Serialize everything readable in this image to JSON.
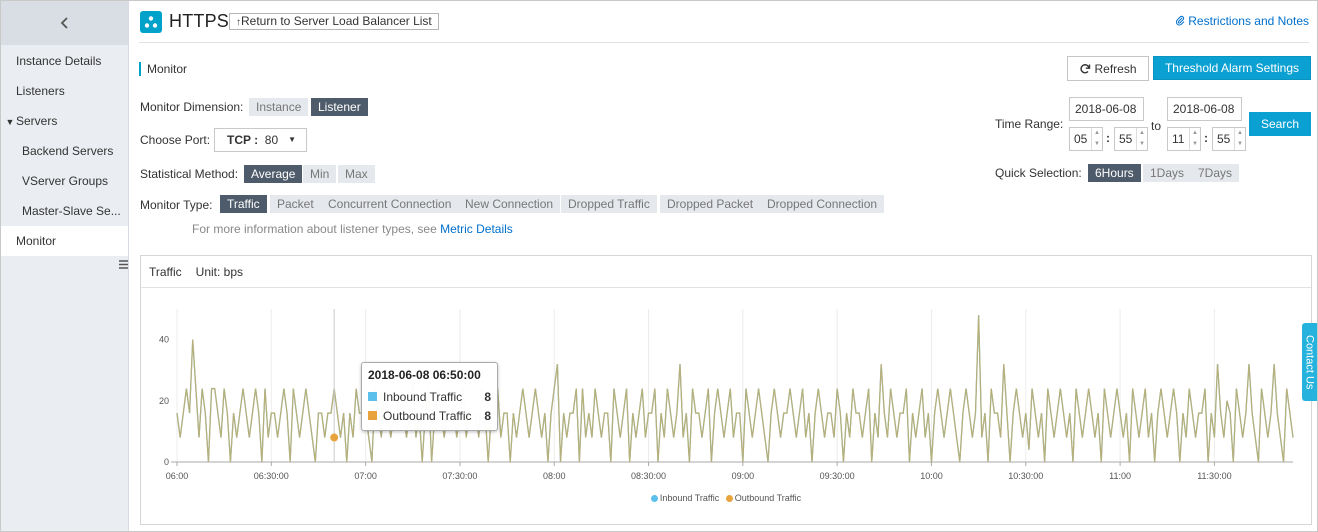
{
  "sidebar": {
    "back_icon": "chevron-left-icon",
    "items": [
      {
        "label": "Instance Details"
      },
      {
        "label": "Listeners"
      },
      {
        "label": "Servers"
      },
      {
        "label": "Backend Servers"
      },
      {
        "label": "VServer Groups"
      },
      {
        "label": "Master-Slave Se..."
      },
      {
        "label": "Monitor",
        "active": true
      }
    ]
  },
  "header": {
    "title": "HTTPS",
    "back_label": "Return to Server Load Balancer List",
    "restrictions_label": "Restrictions and Notes"
  },
  "section": {
    "title": "Monitor",
    "refresh_label": "Refresh",
    "alarm_label": "Threshold Alarm Settings"
  },
  "filters": {
    "dimension_label": "Monitor Dimension:",
    "dimension_options": [
      "Instance",
      "Listener"
    ],
    "dimension_selected": "Listener",
    "port_label": "Choose Port:",
    "port_protocol": "TCP :",
    "port_value": "80",
    "method_label": "Statistical Method:",
    "method_options": [
      "Average",
      "Min",
      "Max"
    ],
    "method_selected": "Average",
    "type_label": "Monitor Type:",
    "type_options": [
      "Traffic",
      "Packet",
      "Concurrent Connection",
      "New Connection",
      "Dropped Traffic",
      "Dropped Packet",
      "Dropped Connection"
    ],
    "type_selected": "Traffic",
    "info_text": "For more information about listener types, see ",
    "info_link": "Metric Details"
  },
  "time_range": {
    "label": "Time Range:",
    "start_date": "2018-06-08",
    "start_hour": "05",
    "start_minute": "55",
    "to_label": "to",
    "end_date": "2018-06-08",
    "end_hour": "11",
    "end_minute": "55",
    "search_label": "Search",
    "quick_label": "Quick Selection:",
    "quick_options": [
      "6Hours",
      "1Days",
      "7Days"
    ],
    "quick_selected": "6Hours"
  },
  "chart_panel": {
    "title": "Traffic",
    "unit": "Unit: bps"
  },
  "tooltip": {
    "time": "2018-06-08 06:50:00",
    "rows": [
      {
        "name": "Inbound Traffic",
        "value": "8"
      },
      {
        "name": "Outbound Traffic",
        "value": "8"
      }
    ]
  },
  "contact_label": "Contact Us",
  "colors": {
    "accent": "#0aa0d2",
    "inbound": "#5bc0eb",
    "outbound": "#e8a33d",
    "line": "#b8b07a"
  },
  "chart_data": {
    "type": "line",
    "title": "Traffic",
    "ylabel": "Unit: bps",
    "ylim": [
      0,
      50
    ],
    "yticks": [
      0,
      20,
      40
    ],
    "x_range": [
      "06:00",
      "11:55"
    ],
    "xticks": [
      "06:00",
      "06:30:00",
      "07:00",
      "07:30:00",
      "08:00",
      "08:30:00",
      "09:00",
      "09:30:00",
      "10:00",
      "10:30:00",
      "11:00",
      "11:30:00"
    ],
    "legend": "bottom-center",
    "grid": true,
    "series": [
      {
        "name": "Inbound Traffic",
        "color": "#5bc0eb",
        "x_start": "06:00",
        "interval_minutes": 1,
        "values": [
          16,
          8,
          16,
          24,
          16,
          40,
          24,
          8,
          24,
          16,
          0,
          24,
          24,
          16,
          8,
          24,
          16,
          0,
          16,
          8,
          16,
          24,
          16,
          8,
          16,
          24,
          16,
          0,
          24,
          8,
          16,
          16,
          8,
          16,
          24,
          16,
          0,
          24,
          16,
          8,
          16,
          24,
          16,
          8,
          0,
          16,
          16,
          8,
          16,
          16,
          24,
          16,
          8,
          16,
          0,
          16,
          8,
          24,
          16,
          16,
          16,
          8,
          0,
          24,
          16,
          8,
          24,
          16,
          8,
          16,
          16,
          24,
          16,
          8,
          16,
          28,
          8,
          16,
          0,
          16,
          24,
          0,
          16,
          24,
          16,
          8,
          16,
          24,
          16,
          8,
          16,
          24,
          8,
          16,
          16,
          16,
          8,
          24,
          16,
          0,
          16,
          16,
          24,
          8,
          16,
          16,
          0,
          16,
          8,
          16,
          24,
          16,
          8,
          16,
          24,
          16,
          8,
          16,
          0,
          16,
          24,
          32,
          0,
          16,
          8,
          16,
          16,
          24,
          0,
          24,
          8,
          16,
          8,
          24,
          16,
          8,
          16,
          16,
          0,
          24,
          16,
          8,
          16,
          24,
          0,
          16,
          8,
          16,
          24,
          8,
          16,
          16,
          24,
          0,
          16,
          8,
          24,
          16,
          8,
          16,
          32,
          8,
          16,
          0,
          24,
          16,
          16,
          8,
          16,
          24,
          0,
          16,
          24,
          16,
          8,
          16,
          24,
          8,
          16,
          16,
          0,
          24,
          16,
          8,
          16,
          24,
          16,
          8,
          0,
          16,
          24,
          16,
          8,
          16,
          16,
          24,
          16,
          8,
          16,
          24,
          8,
          16,
          0,
          16,
          24,
          16,
          8,
          16,
          16,
          8,
          24,
          16,
          0,
          16,
          8,
          24,
          16,
          16,
          8,
          16,
          24,
          0,
          16,
          8,
          32,
          16,
          8,
          24,
          16,
          8,
          16,
          16,
          24,
          0,
          16,
          8,
          16,
          24,
          8,
          16,
          0,
          16,
          24,
          16,
          8,
          16,
          24,
          16,
          8,
          0,
          16,
          24,
          16,
          8,
          16,
          48,
          8,
          16,
          0,
          24,
          16,
          16,
          8,
          32,
          16,
          0,
          16,
          24,
          16,
          8,
          16,
          4,
          24,
          16,
          8,
          16,
          0,
          24,
          16,
          8,
          16,
          24,
          16,
          8,
          16,
          0,
          24,
          16,
          8,
          16,
          24,
          16,
          8,
          16,
          0,
          24,
          16,
          8,
          16,
          24,
          16,
          8,
          16,
          0,
          24,
          16,
          8,
          16,
          24,
          8,
          16,
          0,
          16,
          24,
          16,
          8,
          16,
          24,
          16,
          0,
          16,
          8,
          24,
          16,
          8,
          16,
          16,
          24,
          0,
          16,
          8,
          32,
          16,
          8,
          20,
          16,
          0,
          24,
          16,
          8,
          16,
          32,
          16,
          8,
          0,
          24,
          16,
          8,
          16,
          32,
          16,
          8,
          0,
          24,
          16,
          8
        ]
      },
      {
        "name": "Outbound Traffic",
        "color": "#e8a33d",
        "x_start": "06:00",
        "interval_minutes": 1,
        "values": [
          16,
          8,
          16,
          24,
          16,
          40,
          24,
          8,
          24,
          16,
          0,
          24,
          24,
          16,
          8,
          24,
          16,
          0,
          16,
          8,
          16,
          24,
          16,
          8,
          16,
          24,
          16,
          0,
          24,
          8,
          16,
          16,
          8,
          16,
          24,
          16,
          0,
          24,
          16,
          8,
          16,
          24,
          16,
          8,
          0,
          16,
          16,
          8,
          16,
          16,
          24,
          16,
          8,
          16,
          0,
          16,
          8,
          24,
          16,
          16,
          16,
          8,
          0,
          24,
          16,
          8,
          24,
          16,
          8,
          16,
          16,
          24,
          16,
          8,
          16,
          28,
          8,
          16,
          0,
          16,
          24,
          0,
          16,
          24,
          16,
          8,
          16,
          24,
          16,
          8,
          16,
          24,
          8,
          16,
          16,
          16,
          8,
          24,
          16,
          0,
          16,
          16,
          24,
          8,
          16,
          16,
          0,
          16,
          8,
          16,
          24,
          16,
          8,
          16,
          24,
          16,
          8,
          16,
          0,
          16,
          24,
          32,
          0,
          16,
          8,
          16,
          16,
          24,
          0,
          24,
          8,
          16,
          8,
          24,
          16,
          8,
          16,
          16,
          0,
          24,
          16,
          8,
          16,
          24,
          0,
          16,
          8,
          16,
          24,
          8,
          16,
          16,
          24,
          0,
          16,
          8,
          24,
          16,
          8,
          16,
          32,
          8,
          16,
          0,
          24,
          16,
          16,
          8,
          16,
          24,
          0,
          16,
          24,
          16,
          8,
          16,
          24,
          8,
          16,
          16,
          0,
          24,
          16,
          8,
          16,
          24,
          16,
          8,
          0,
          16,
          24,
          16,
          8,
          16,
          16,
          24,
          16,
          8,
          16,
          24,
          8,
          16,
          0,
          16,
          24,
          16,
          8,
          16,
          16,
          8,
          24,
          16,
          0,
          16,
          8,
          24,
          16,
          16,
          8,
          16,
          24,
          0,
          16,
          8,
          32,
          16,
          8,
          24,
          16,
          8,
          16,
          16,
          24,
          0,
          16,
          8,
          16,
          24,
          8,
          16,
          0,
          16,
          24,
          16,
          8,
          16,
          24,
          16,
          8,
          0,
          16,
          24,
          16,
          8,
          16,
          48,
          8,
          16,
          0,
          24,
          16,
          16,
          8,
          32,
          16,
          0,
          16,
          24,
          16,
          8,
          16,
          4,
          24,
          16,
          8,
          16,
          0,
          24,
          16,
          8,
          16,
          24,
          16,
          8,
          16,
          0,
          24,
          16,
          8,
          16,
          24,
          16,
          8,
          16,
          0,
          24,
          16,
          8,
          16,
          24,
          16,
          8,
          16,
          0,
          24,
          16,
          8,
          16,
          24,
          8,
          16,
          0,
          16,
          24,
          16,
          8,
          16,
          24,
          16,
          0,
          16,
          8,
          24,
          16,
          8,
          16,
          16,
          24,
          0,
          16,
          8,
          32,
          16,
          8,
          20,
          16,
          0,
          24,
          16,
          8,
          16,
          32,
          16,
          8,
          0,
          24,
          16,
          8,
          16,
          32,
          16,
          8,
          0,
          24,
          16,
          8
        ]
      }
    ]
  }
}
